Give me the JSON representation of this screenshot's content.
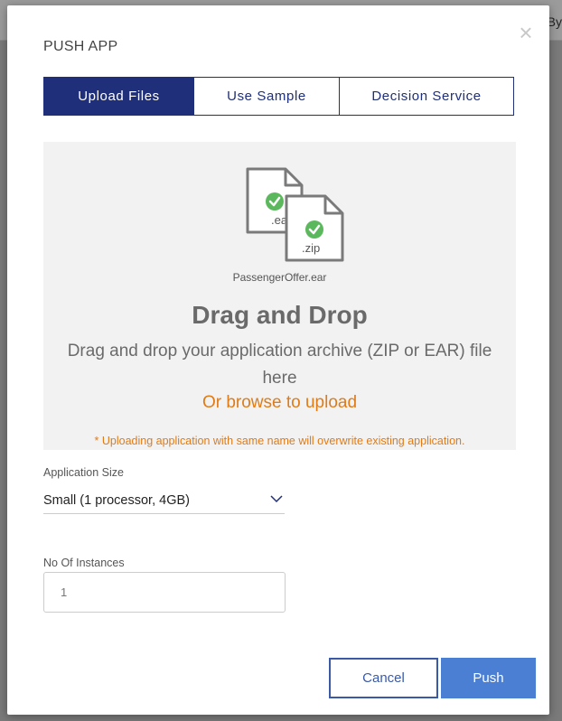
{
  "background": {
    "partial_text": "By"
  },
  "modal": {
    "title": "PUSH APP",
    "close_glyph": "×",
    "tabs": [
      {
        "label": "Upload Files",
        "active": true
      },
      {
        "label": "Use Sample",
        "active": false
      },
      {
        "label": "Decision Service",
        "active": false
      }
    ]
  },
  "dropzone": {
    "icons": [
      {
        "name": "ear-file-icon",
        "label": ".ear"
      },
      {
        "name": "zip-file-icon",
        "label": ".zip"
      }
    ],
    "file_name": "PassengerOffer.ear",
    "title": "Drag and Drop",
    "description": "Drag and drop your application archive (ZIP or EAR) file here",
    "browse_link": "Or browse to upload",
    "warning": "* Uploading application with same name will overwrite existing application."
  },
  "form": {
    "size_label": "Application Size",
    "size_value": "Small (1 processor, 4GB)",
    "instances_label": "No Of Instances",
    "instances_value": "1"
  },
  "buttons": {
    "cancel": "Cancel",
    "push": "Push"
  },
  "colors": {
    "primary": "#1f2f79",
    "accent_orange": "#e07b16",
    "button_blue": "#4a7fd4",
    "check_green": "#5cb85c"
  }
}
